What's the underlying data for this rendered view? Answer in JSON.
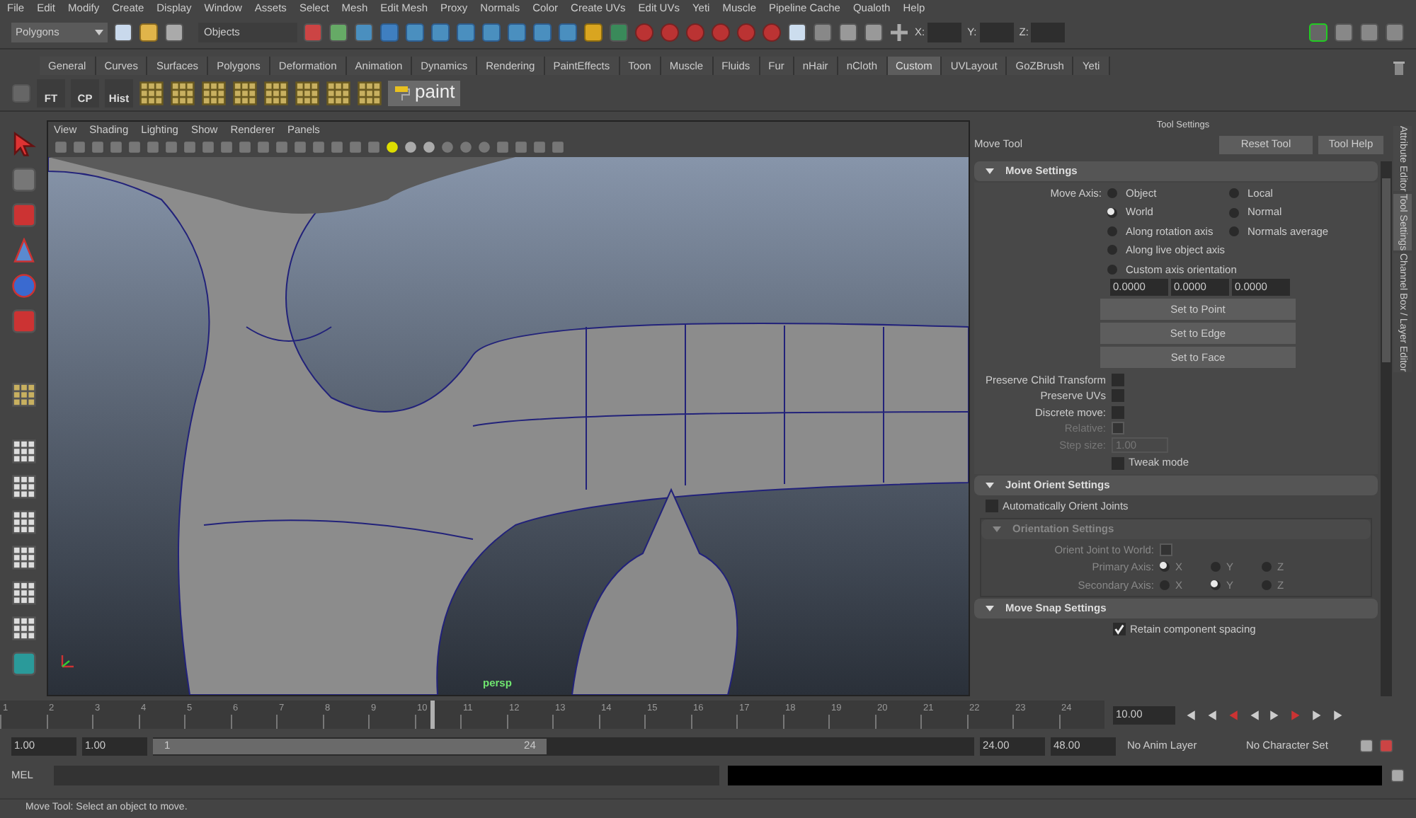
{
  "menu_bar": [
    "File",
    "Edit",
    "Modify",
    "Create",
    "Display",
    "Window",
    "Assets",
    "Select",
    "Mesh",
    "Edit Mesh",
    "Proxy",
    "Normals",
    "Color",
    "Create UVs",
    "Edit UVs",
    "Yeti",
    "Muscle",
    "Pipeline Cache",
    "Qualoth",
    "Help"
  ],
  "status_line": {
    "menu_set": "Polygons",
    "selection_mode": "Objects",
    "coord_labels": [
      "X:",
      "Y:",
      "Z:"
    ]
  },
  "shelf_tabs": [
    {
      "label": "General",
      "selected": false
    },
    {
      "label": "Curves",
      "selected": false
    },
    {
      "label": "Surfaces",
      "selected": false
    },
    {
      "label": "Polygons",
      "selected": false
    },
    {
      "label": "Deformation",
      "selected": false
    },
    {
      "label": "Animation",
      "selected": false
    },
    {
      "label": "Dynamics",
      "selected": false
    },
    {
      "label": "Rendering",
      "selected": false
    },
    {
      "label": "PaintEffects",
      "selected": false
    },
    {
      "label": "Toon",
      "selected": false
    },
    {
      "label": "Muscle",
      "selected": false
    },
    {
      "label": "Fluids",
      "selected": false
    },
    {
      "label": "Fur",
      "selected": false
    },
    {
      "label": "nHair",
      "selected": false
    },
    {
      "label": "nCloth",
      "selected": false
    },
    {
      "label": "Custom",
      "selected": true
    },
    {
      "label": "UVLayout",
      "selected": false
    },
    {
      "label": "GoZBrush",
      "selected": false
    },
    {
      "label": "Yeti",
      "selected": false
    }
  ],
  "shelf": {
    "labeled_buttons": [
      "FT",
      "CP",
      "Hist"
    ],
    "paint_button": "paint"
  },
  "viewport": {
    "menus": [
      "View",
      "Shading",
      "Lighting",
      "Show",
      "Renderer",
      "Panels"
    ],
    "camera_label": "persp"
  },
  "tool_settings": {
    "panel_title": "Tool Settings",
    "tool_name": "Move Tool",
    "buttons": [
      "Reset Tool",
      "Tool Help"
    ],
    "move_settings": {
      "title": "Move Settings",
      "axis_label": "Move Axis:",
      "axis_column_1": [
        {
          "label": "Object",
          "selected": false
        },
        {
          "label": "World",
          "selected": true
        },
        {
          "label": "Along rotation axis",
          "selected": false
        },
        {
          "label": "Along live object axis",
          "selected": false
        },
        {
          "label": "Custom axis orientation",
          "selected": false
        }
      ],
      "axis_column_2": [
        {
          "label": "Local",
          "selected": false
        },
        {
          "label": "Normal",
          "selected": false
        },
        {
          "label": "Normals average",
          "selected": false
        }
      ],
      "axis_values": [
        "0.0000",
        "0.0000",
        "0.0000"
      ],
      "set_buttons": [
        "Set to Point",
        "Set to Edge",
        "Set to Face"
      ],
      "options": [
        {
          "kind": "checkbox",
          "label": "Preserve Child Transform",
          "checked": false,
          "disabled": false
        },
        {
          "kind": "checkbox",
          "label": "Preserve UVs",
          "checked": false,
          "disabled": false
        },
        {
          "kind": "checkbox",
          "label": "Discrete move:",
          "checked": false,
          "disabled": false
        },
        {
          "kind": "checkbox",
          "label": "Relative:",
          "checked": false,
          "disabled": true
        },
        {
          "kind": "field",
          "label": "Step size:",
          "value": "1.00",
          "disabled": true
        },
        {
          "kind": "toggle",
          "label": "Tweak mode",
          "checked": false,
          "disabled": false
        }
      ]
    },
    "joint_orient_settings": {
      "title": "Joint Orient Settings",
      "auto_orient": {
        "label": "Automatically Orient Joints",
        "checked": false
      },
      "orientation_settings": {
        "title": "Orientation Settings",
        "orient_to_world": {
          "label": "Orient Joint to World:",
          "checked": false
        },
        "axes": [
          {
            "label": "Primary Axis:",
            "options": [
              {
                "label": "X",
                "selected": true
              },
              {
                "label": "Y",
                "selected": false
              },
              {
                "label": "Z",
                "selected": false
              }
            ]
          },
          {
            "label": "Secondary Axis:",
            "options": [
              {
                "label": "X",
                "selected": false
              },
              {
                "label": "Y",
                "selected": true
              },
              {
                "label": "Z",
                "selected": false
              }
            ]
          }
        ]
      }
    },
    "move_snap_settings": {
      "title": "Move Snap Settings",
      "retain_spacing": {
        "label": "Retain component spacing",
        "checked": true
      }
    }
  },
  "side_tabs": [
    {
      "label": "Attribute Editor",
      "selected": false
    },
    {
      "label": "Tool Settings",
      "selected": true
    },
    {
      "label": "Channel Box / Layer Editor",
      "selected": false
    }
  ],
  "timeline": {
    "ticks": [
      "1",
      "2",
      "3",
      "4",
      "5",
      "6",
      "7",
      "8",
      "9",
      "10",
      "11",
      "12",
      "13",
      "14",
      "15",
      "16",
      "17",
      "18",
      "19",
      "20",
      "21",
      "22",
      "23",
      "24"
    ],
    "current_time": "10.00",
    "level": 0.39
  },
  "range_slider": {
    "start": "1.00",
    "playback_start": "1.00",
    "slider_start": "1",
    "slider_end": "24",
    "level": 0.48,
    "playback_end": "24.00",
    "end": "48.00",
    "anim_layer": "No Anim Layer",
    "character_set": "No Character Set"
  },
  "command_line": {
    "label": "MEL"
  },
  "help_line": "Move Tool: Select an object to move."
}
